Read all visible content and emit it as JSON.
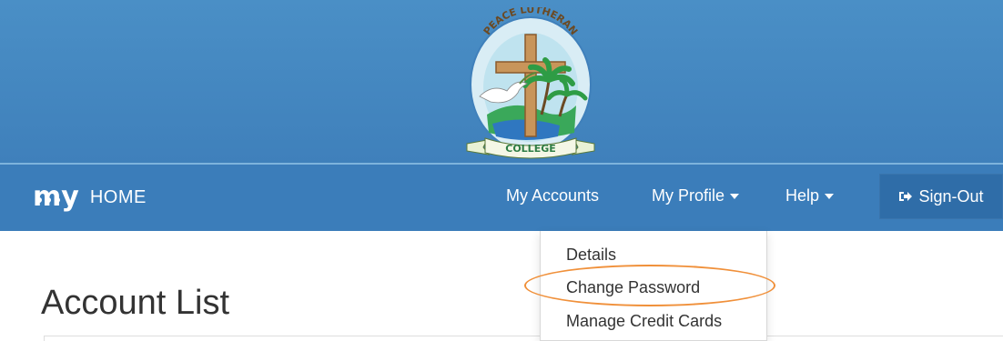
{
  "header": {
    "crest": {
      "top_text": "PEACE LUTHERAN",
      "ribbon_text": "COLLEGE"
    }
  },
  "navbar": {
    "brand_logo": "my",
    "brand_label": "HOME",
    "items": [
      {
        "label": "My Accounts"
      },
      {
        "label": "My Profile",
        "has_caret": true
      },
      {
        "label": "Help",
        "has_caret": true
      }
    ],
    "signout_label": "Sign-Out",
    "signout_icon": "sign-out-icon"
  },
  "profile_menu": {
    "items": [
      {
        "label": "Details"
      },
      {
        "label": "Change Password",
        "highlighted": true
      },
      {
        "label": "Manage Credit Cards"
      }
    ],
    "highlight_color": "#f0903a"
  },
  "main": {
    "title": "Account List"
  },
  "colors": {
    "banner": "#4a8fc6",
    "navbar": "#3b7dba",
    "signout_bg": "#2f6da8"
  }
}
